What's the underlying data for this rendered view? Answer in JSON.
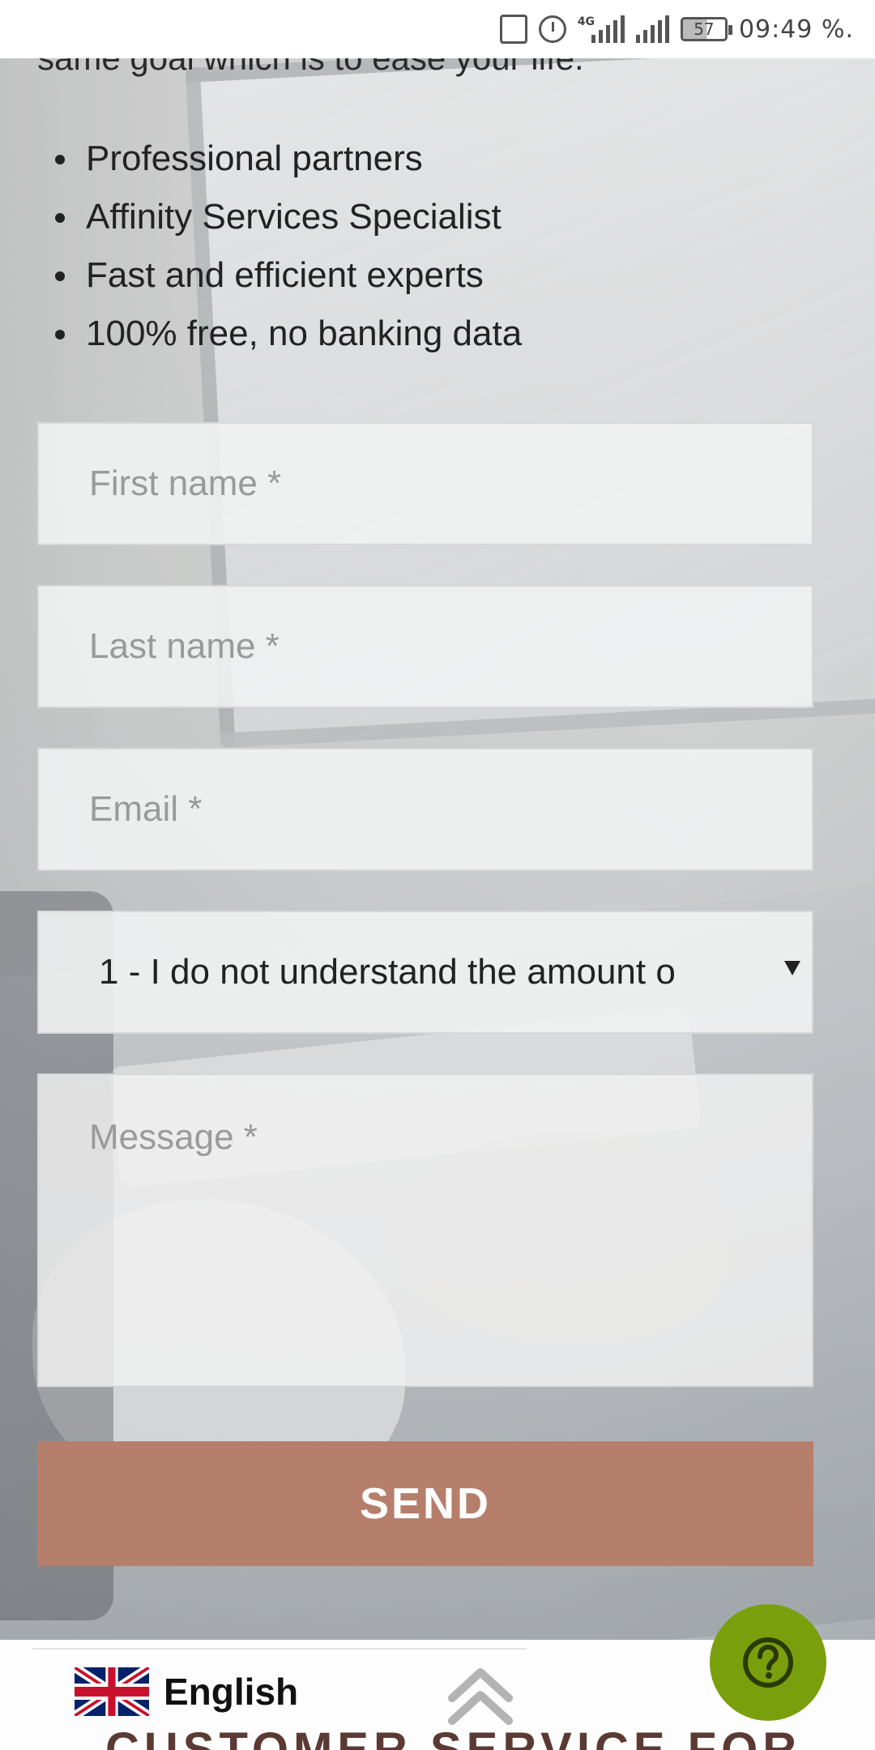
{
  "status_bar": {
    "network": "4G",
    "battery": "57",
    "time": "09:49",
    "suffix": "%."
  },
  "intro": {
    "tail_text": "same goal which is to ease your life."
  },
  "features": [
    "Professional partners",
    "Affinity Services Specialist",
    "Fast and efficient experts",
    "100% free, no banking data"
  ],
  "form": {
    "first_name_placeholder": "First name *",
    "last_name_placeholder": "Last name *",
    "email_placeholder": "Email *",
    "topic_selected": "1 - I do not understand the amount o",
    "message_placeholder": "Message *",
    "send_label": "SEND"
  },
  "footer": {
    "language": "English",
    "peek_heading": "CUSTOMER SERVICE FOR"
  },
  "colors": {
    "send_button": "#b57f6c",
    "help_button": "#7a9f0c"
  },
  "icons": {
    "scroll_top": "double-chevron-up-icon",
    "help": "question-mark-icon",
    "flag": "uk-flag-icon"
  }
}
